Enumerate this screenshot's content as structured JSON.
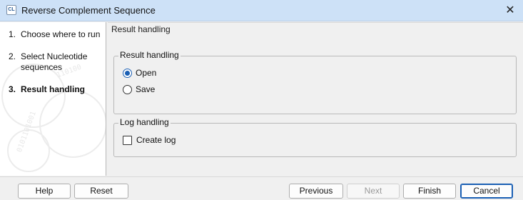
{
  "window": {
    "title": "Reverse Complement Sequence",
    "app_icon": "clc-app-icon",
    "close_glyph": "✕"
  },
  "steps": [
    {
      "num": "1.",
      "label": "Choose where to run",
      "active": false
    },
    {
      "num": "2.",
      "label": "Select Nucleotide sequences",
      "active": false
    },
    {
      "num": "3.",
      "label": "Result handling",
      "active": true
    }
  ],
  "panel": {
    "header": "Result handling",
    "result_group": {
      "title": "Result handling",
      "options": [
        {
          "label": "Open",
          "checked": true
        },
        {
          "label": "Save",
          "checked": false
        }
      ]
    },
    "log_group": {
      "title": "Log handling",
      "create_log_label": "Create log",
      "create_log_checked": false
    }
  },
  "footer": {
    "help": "Help",
    "reset": "Reset",
    "previous": "Previous",
    "next": "Next",
    "finish": "Finish",
    "cancel": "Cancel"
  },
  "colors": {
    "titlebar": "#cde1f7",
    "accent": "#1a5fb4"
  }
}
